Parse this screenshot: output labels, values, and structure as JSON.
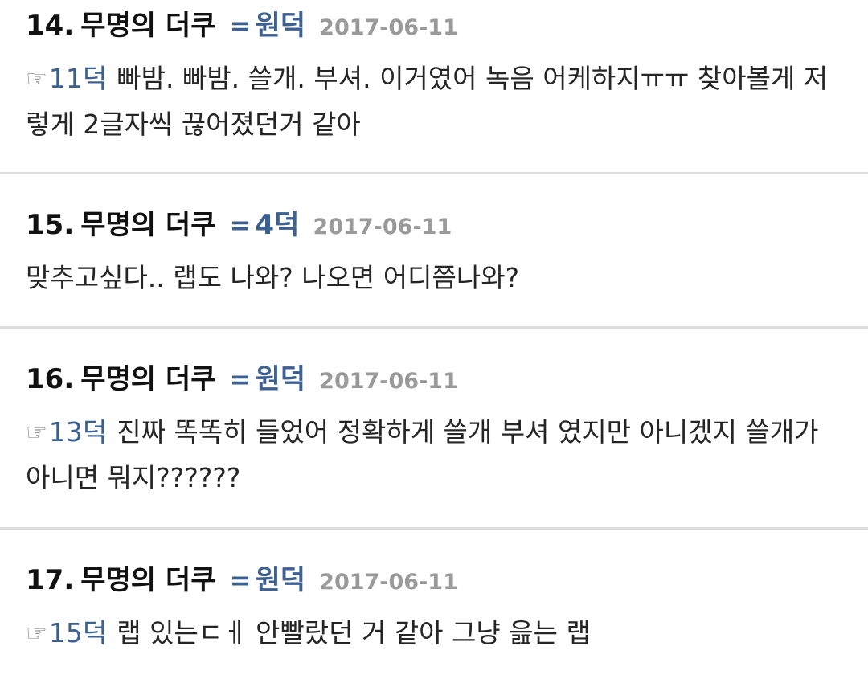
{
  "comments": [
    {
      "number": "14",
      "author": "무명의 더쿠",
      "eq": "=",
      "duck": "원덕",
      "date": "2017-06-11",
      "reply": "11덕",
      "text": "빠밤. 빠밤. 쓸개. 부셔. 이거였어 녹음 어케하지ㅠㅠ 찾아볼게 저렇게 2글자씩 끊어졌던거 같아"
    },
    {
      "number": "15",
      "author": "무명의 더쿠",
      "eq": "=",
      "duck": "4덕",
      "date": "2017-06-11",
      "reply": "",
      "text": "맞추고싶다.. 랩도 나와? 나오면 어디쯤나와?"
    },
    {
      "number": "16",
      "author": "무명의 더쿠",
      "eq": "=",
      "duck": "원덕",
      "date": "2017-06-11",
      "reply": "13덕",
      "text": "진짜 똑똑히 들었어 정확하게 쓸개 부셔 였지만 아니겠지 쓸개가 아니면 뭐지??????"
    },
    {
      "number": "17",
      "author": "무명의 더쿠",
      "eq": "=",
      "duck": "원덕",
      "date": "2017-06-11",
      "reply": "15덕",
      "text": "랩 있는ㄷㅔ 안빨랐던 거 같아 그냥 읊는 랩"
    }
  ],
  "icons": {
    "reply_pointer": "hand-pointing-right-icon"
  },
  "colors": {
    "link": "#3c6191",
    "date": "#9a9a9a",
    "divider": "#dcdcdc"
  }
}
